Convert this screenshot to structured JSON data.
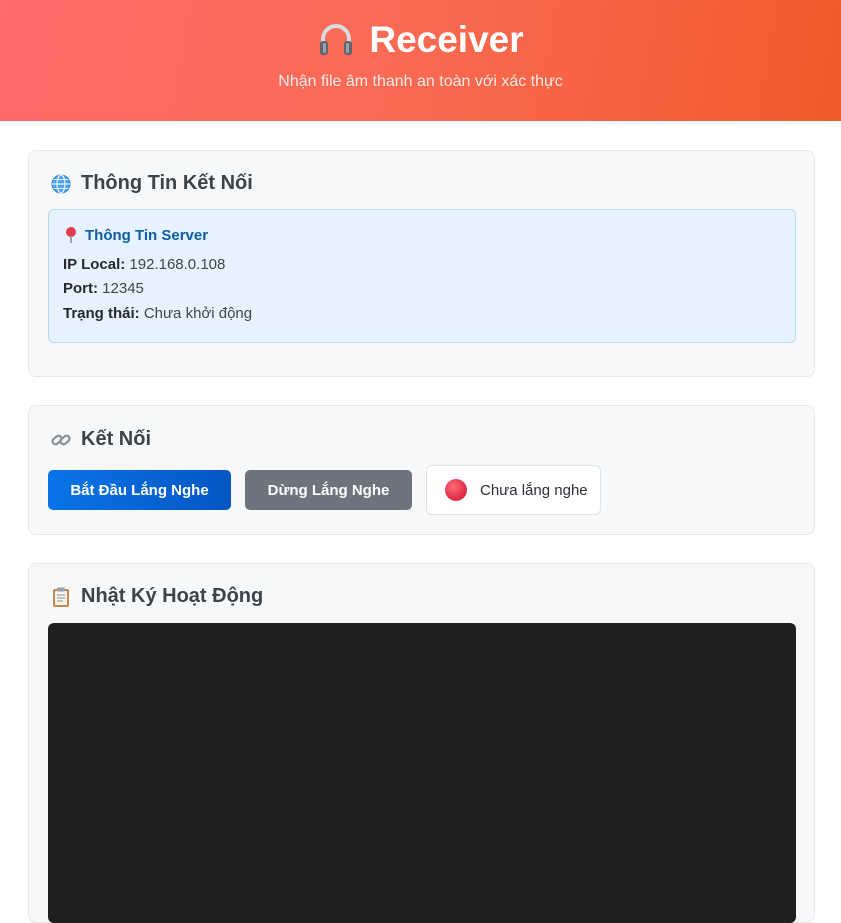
{
  "header": {
    "icon": "headphones-icon",
    "title": "Receiver",
    "subtitle": "Nhận file âm thanh an toàn với xác thực"
  },
  "connection_info": {
    "icon": "globe-icon",
    "title": "Thông Tin Kết Nối",
    "server": {
      "icon": "pin-icon",
      "title": "Thông Tin Server",
      "ip_label": "IP Local:",
      "ip_value": "192.168.0.108",
      "port_label": "Port:",
      "port_value": "12345",
      "status_label": "Trạng thái:",
      "status_value": "Chưa khởi động"
    }
  },
  "connect": {
    "icon": "link-icon",
    "title": "Kết Nối",
    "start_button": "Bắt Đầu Lắng Nghe",
    "stop_button": "Dừng Lắng Nghe",
    "status_text": "Chưa lắng nghe",
    "status_color": "#e4344d"
  },
  "activity_log": {
    "icon": "clipboard-icon",
    "title": "Nhật Ký Hoạt Động",
    "entries": []
  },
  "colors": {
    "header_start": "#ff6a6a",
    "header_end": "#f15a2b",
    "primary": "#0a73e8",
    "secondary": "#6d747d",
    "log_bg": "#1f1f1f"
  }
}
